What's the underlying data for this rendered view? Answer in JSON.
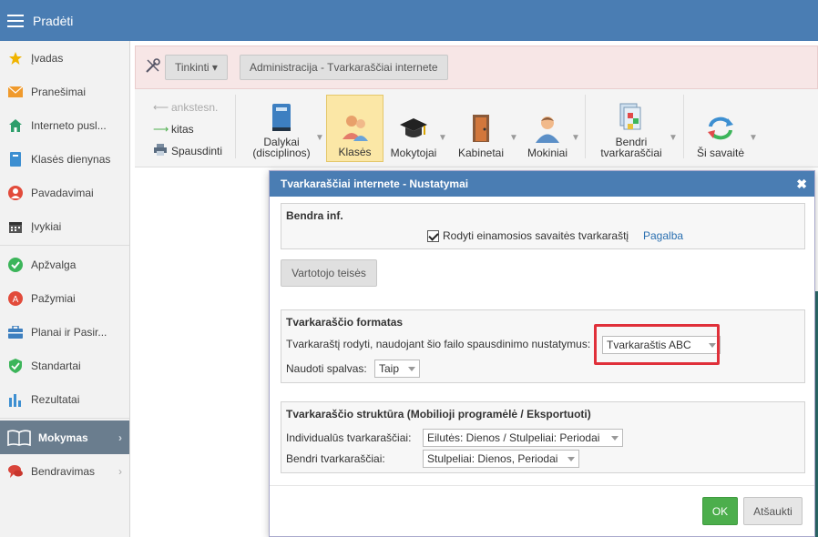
{
  "topbar": {
    "title": "Pradėti"
  },
  "sidebar": {
    "items": [
      {
        "label": "Įvadas",
        "icon": "star-icon",
        "color": "#f0b400"
      },
      {
        "label": "Pranešimai",
        "icon": "envelope-icon",
        "color": "#f09a2c"
      },
      {
        "label": "Interneto pusl...",
        "icon": "house-icon",
        "color": "#2e9e6b"
      },
      {
        "label": "Klasės dienynas",
        "icon": "book-icon",
        "color": "#3d8fd1"
      },
      {
        "label": "Pavadavimai",
        "icon": "person-icon",
        "color": "#e24b3b"
      },
      {
        "label": "Įvykiai",
        "icon": "calendar-icon",
        "color": "#555555"
      },
      {
        "label": "Apžvalga",
        "icon": "check-circle-icon",
        "color": "#3cb55a"
      },
      {
        "label": "Pažymiai",
        "icon": "grade-icon",
        "color": "#e24b3b"
      },
      {
        "label": "Planai ir Pasir...",
        "icon": "briefcase-icon",
        "color": "#3d7fbf"
      },
      {
        "label": "Standartai",
        "icon": "shield-icon",
        "color": "#3cb55a"
      },
      {
        "label": "Rezultatai",
        "icon": "bar-chart-icon",
        "color": "#3d8fd1"
      },
      {
        "label": "Mokymas",
        "icon": "open-book-icon",
        "color": "#ffffff"
      },
      {
        "label": "Bendravimas",
        "icon": "chat-icon",
        "color": "#d9443a"
      }
    ]
  },
  "toolbar": {
    "settings_label": "Tinkinti ▾",
    "breadcrumb": "Administracija - Tvarkaraščiai internete"
  },
  "ribbon": {
    "prev": "ankstesn.",
    "next": "kitas",
    "print": "Spausdinti",
    "buttons": {
      "subjects": "Dalykai\n(disciplinos)",
      "classes": "Klasės",
      "teachers": "Mokytojai",
      "rooms": "Kabinetai",
      "students": "Mokiniai",
      "common": "Bendri\ntvarkaraščiai",
      "this_week": "Ši savaitė"
    }
  },
  "dialog": {
    "title": "Tvarkaraščiai internete - Nustatymai",
    "general": {
      "title": "Bendra inf.",
      "checkbox_label": "Rodyti einamosios savaitės tvarkaraštį",
      "help_link": "Pagalba"
    },
    "user_rights_button": "Vartotojo teisės",
    "format": {
      "title": "Tvarkaraščio formatas",
      "print_label": "Tvarkaraštį rodyti, naudojant šio failo spausdinimo nustatymus:",
      "print_value": "Tvarkaraštis ABC",
      "colors_label": "Naudoti spalvas:",
      "colors_value": "Taip"
    },
    "structure": {
      "title": "Tvarkaraščio struktūra (Mobilioji programėlė / Eksportuoti)",
      "individual_label": "Individualūs tvarkaraščiai:",
      "individual_value": "Eilutės: Dienos / Stulpeliai: Periodai",
      "common_label": "Bendri tvarkaraščiai:",
      "common_value": "Stulpeliai: Dienos, Periodai"
    },
    "ok": "OK",
    "cancel": "Atšaukti"
  }
}
